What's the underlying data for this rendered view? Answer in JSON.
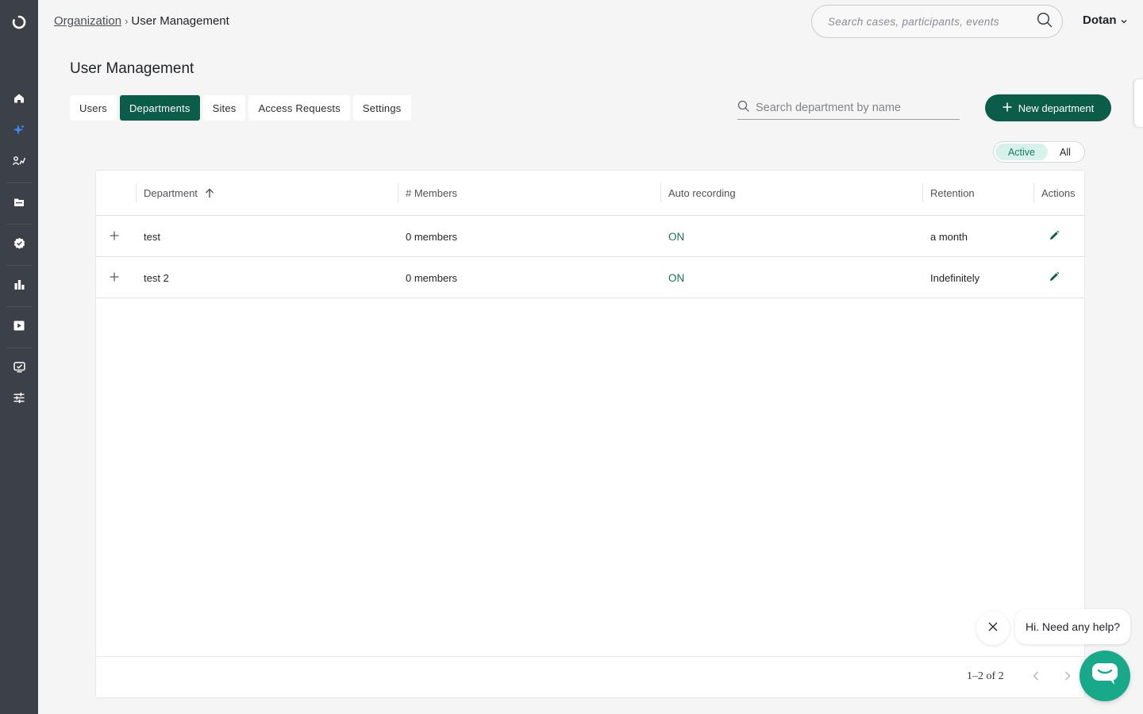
{
  "sidebar": {
    "logo_icon": "app-logo-icon",
    "items": [
      {
        "name": "home",
        "icon": "home-icon"
      },
      {
        "name": "ai",
        "icon": "sparkle-icon",
        "active": true
      },
      {
        "name": "analytics",
        "icon": "people-chart-icon"
      },
      {
        "name": "cases",
        "icon": "folder-icon"
      },
      {
        "name": "compliance",
        "icon": "badge-check-icon"
      },
      {
        "name": "reports",
        "icon": "bar-chart-icon"
      },
      {
        "name": "media",
        "icon": "play-icon"
      },
      {
        "name": "monitor",
        "icon": "monitor-icon"
      },
      {
        "name": "settings",
        "icon": "sliders-icon"
      }
    ]
  },
  "header": {
    "breadcrumb": {
      "parent": "Organization",
      "separator": "›",
      "current": "User Management"
    },
    "search_placeholder": "Search cases, participants, events",
    "user_name": "Dotan"
  },
  "page": {
    "title": "User Management",
    "tabs": [
      {
        "label": "Users",
        "active": false
      },
      {
        "label": "Departments",
        "active": true
      },
      {
        "label": "Sites",
        "active": false
      },
      {
        "label": "Access Requests",
        "active": false
      },
      {
        "label": "Settings",
        "active": false
      }
    ],
    "dept_search_placeholder": "Search department by name",
    "new_button_label": "New department",
    "filter": {
      "active_label": "Active",
      "all_label": "All",
      "selected": "Active"
    }
  },
  "table": {
    "columns": {
      "department": "Department",
      "members": "# Members",
      "auto_recording": "Auto recording",
      "retention": "Retention",
      "actions": "Actions"
    },
    "sort": {
      "column": "department",
      "direction": "ascending"
    },
    "rows": [
      {
        "department": "test",
        "members": "0 members",
        "auto_recording": "ON",
        "retention": "a month"
      },
      {
        "department": "test 2",
        "members": "0 members",
        "auto_recording": "ON",
        "retention": "Indefinitely"
      }
    ],
    "pagination": "1–2 of 2"
  },
  "chat": {
    "greeting": "Hi. Need any help?"
  },
  "colors": {
    "accent": "#0b5c48",
    "on_status": "#17744f",
    "chat": "#17a98a",
    "sidebar": "#3c4149"
  }
}
